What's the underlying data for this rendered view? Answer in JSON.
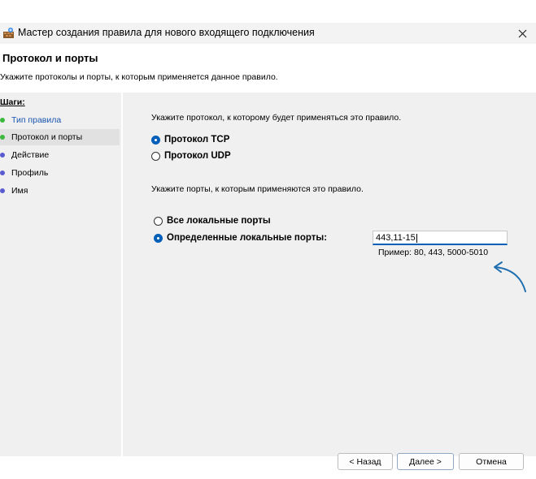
{
  "window": {
    "title": "Мастер создания правила для нового входящего подключения"
  },
  "header": {
    "title": "Протокол и порты",
    "subtitle": "Укажите протоколы и порты, к которым применяется данное правило."
  },
  "steps": {
    "title": "Шаги:",
    "items": [
      {
        "label": "Тип правила",
        "state": "done"
      },
      {
        "label": "Протокол и порты",
        "state": "active"
      },
      {
        "label": "Действие",
        "state": "pending"
      },
      {
        "label": "Профиль",
        "state": "pending"
      },
      {
        "label": "Имя",
        "state": "pending"
      }
    ]
  },
  "main": {
    "protocol_prompt": "Укажите протокол, к которому будет применяться это правило.",
    "protocol_tcp": "Протокол TCP",
    "protocol_udp": "Протокол UDP",
    "ports_prompt": "Укажите порты, к которым применяются это правило.",
    "all_ports": "Все локальные порты",
    "specific_ports": "Определенные локальные порты:",
    "ports_value": "443,11-15",
    "example": "Пример: 80, 443, 5000-5010"
  },
  "buttons": {
    "back": "< Назад",
    "next": "Далее >",
    "cancel": "Отмена"
  },
  "colors": {
    "accent": "#005fb8",
    "done_dot": "#3cb83c",
    "pending_dot": "#5a5ad0",
    "annotation_arrow": "#1f6fb0"
  }
}
